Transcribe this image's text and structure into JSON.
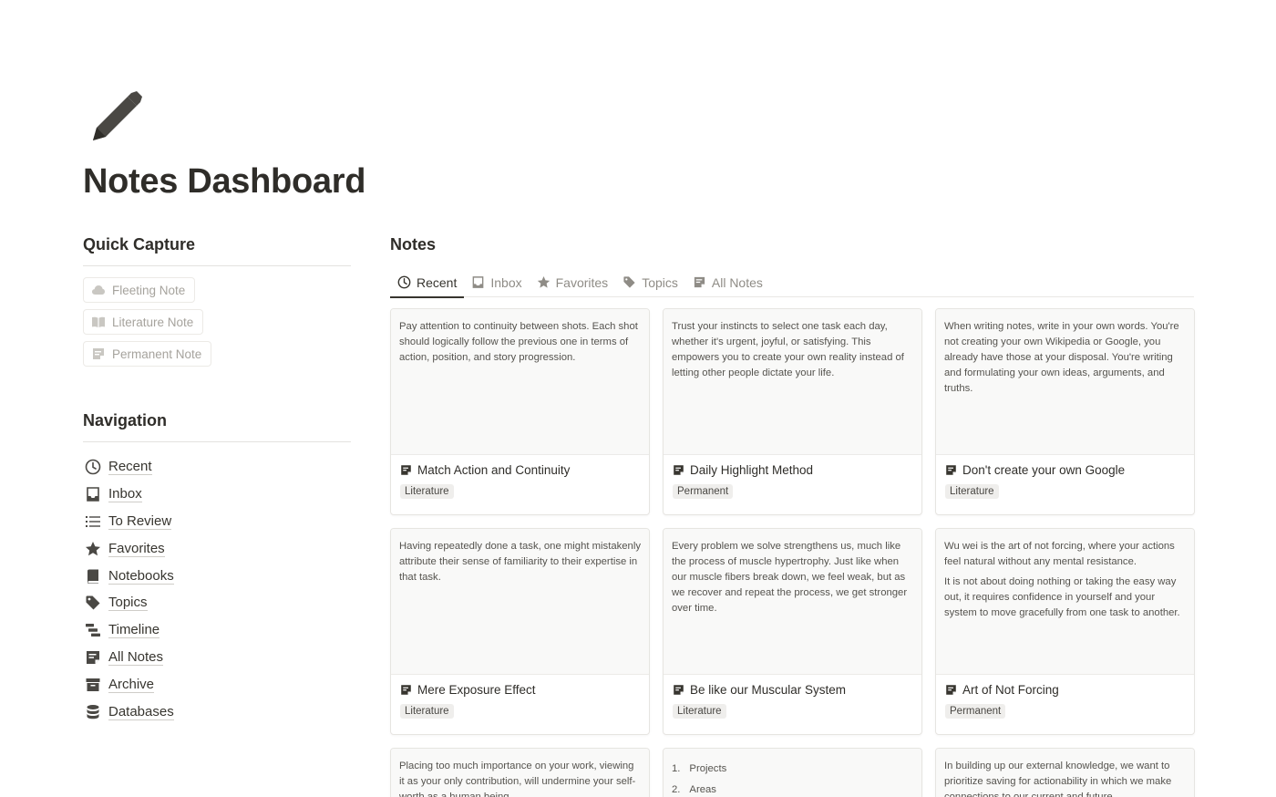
{
  "page": {
    "icon": "pencil-icon",
    "title": "Notes Dashboard"
  },
  "quick_capture": {
    "heading": "Quick Capture",
    "buttons": [
      {
        "label": "Fleeting Note",
        "icon": "cloud-icon"
      },
      {
        "label": "Literature Note",
        "icon": "book-open-icon"
      },
      {
        "label": "Permanent Note",
        "icon": "sticky-note-icon"
      }
    ]
  },
  "navigation": {
    "heading": "Navigation",
    "items": [
      {
        "label": "Recent",
        "icon": "clock-icon"
      },
      {
        "label": "Inbox",
        "icon": "inbox-icon"
      },
      {
        "label": "To Review",
        "icon": "list-icon"
      },
      {
        "label": "Favorites",
        "icon": "star-icon"
      },
      {
        "label": "Notebooks",
        "icon": "notebook-icon"
      },
      {
        "label": "Topics",
        "icon": "tag-icon"
      },
      {
        "label": "Timeline",
        "icon": "timeline-icon"
      },
      {
        "label": "All Notes",
        "icon": "sticky-note-icon"
      },
      {
        "label": "Archive",
        "icon": "archive-icon"
      },
      {
        "label": "Databases",
        "icon": "database-icon"
      }
    ]
  },
  "notes": {
    "heading": "Notes",
    "tabs": [
      {
        "label": "Recent",
        "icon": "clock-icon",
        "active": true
      },
      {
        "label": "Inbox",
        "icon": "inbox-icon"
      },
      {
        "label": "Favorites",
        "icon": "star-icon"
      },
      {
        "label": "Topics",
        "icon": "tag-icon"
      },
      {
        "label": "All Notes",
        "icon": "sticky-note-icon"
      }
    ],
    "cards": [
      {
        "preview": [
          "Pay attention to continuity between shots. Each shot should logically follow the previous one in terms of action, position, and story progression."
        ],
        "title": "Match Action and Continuity",
        "tag": "Literature"
      },
      {
        "preview": [
          "Trust your instincts to select one task each day, whether it's urgent, joyful, or satisfying. This empowers you to create your own reality instead of letting other people dictate your life."
        ],
        "title": "Daily Highlight Method",
        "tag": "Permanent"
      },
      {
        "preview": [
          "When writing notes, write in your own words. You're not creating your own Wikipedia or Google, you already have those at your disposal. You're writing and formulating your own ideas, arguments, and truths."
        ],
        "title": "Don't create your own Google",
        "tag": "Literature"
      },
      {
        "preview": [
          "Having repeatedly done a task, one might mistakenly attribute their sense of familiarity to their expertise in that task."
        ],
        "title": "Mere Exposure Effect",
        "tag": "Literature"
      },
      {
        "preview": [
          "Every problem we solve strengthens us, much like the process of muscle hypertrophy. Just like when our muscle fibers break down, we feel weak, but as we recover and repeat the process, we get stronger over time."
        ],
        "title": "Be like our Muscular System",
        "tag": "Literature"
      },
      {
        "preview": [
          "Wu wei is the art of not forcing, where your actions feel natural without any mental resistance.",
          "It is not about doing nothing or taking the easy way out, it requires confidence in yourself and your system to move gracefully from one task to another."
        ],
        "title": "Art of Not Forcing",
        "tag": "Permanent"
      }
    ],
    "partial_cards": [
      {
        "preview": "Placing too much importance on your work, viewing it as your only contribution, will undermine your self-worth as a human being"
      },
      {
        "list": [
          {
            "num": "1.",
            "text": "Projects"
          },
          {
            "num": "2.",
            "text": "Areas"
          }
        ]
      },
      {
        "preview": "In building up our external knowledge, we want to prioritize saving for actionability in which we make connections to our current and future"
      }
    ]
  }
}
